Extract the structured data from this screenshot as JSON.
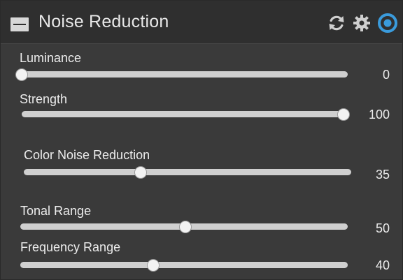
{
  "panel": {
    "title": "Noise Reduction",
    "icons": {
      "collapse": "minus-box-icon",
      "reset": "refresh-icon",
      "settings": "gear-icon",
      "toggle": "power-toggle-icon"
    },
    "accent_color": "#3a9bdc"
  },
  "sliders": [
    {
      "label": "Luminance",
      "value": "0",
      "fraction": 0.0
    },
    {
      "label": "Strength",
      "value": "100",
      "fraction": 1.0
    },
    {
      "label": "Color Noise Reduction",
      "value": "35",
      "fraction": 0.35
    },
    {
      "label": "Tonal Range",
      "value": "50",
      "fraction": 0.5
    },
    {
      "label": "Frequency Range",
      "value": "40",
      "fraction": 0.4
    }
  ]
}
